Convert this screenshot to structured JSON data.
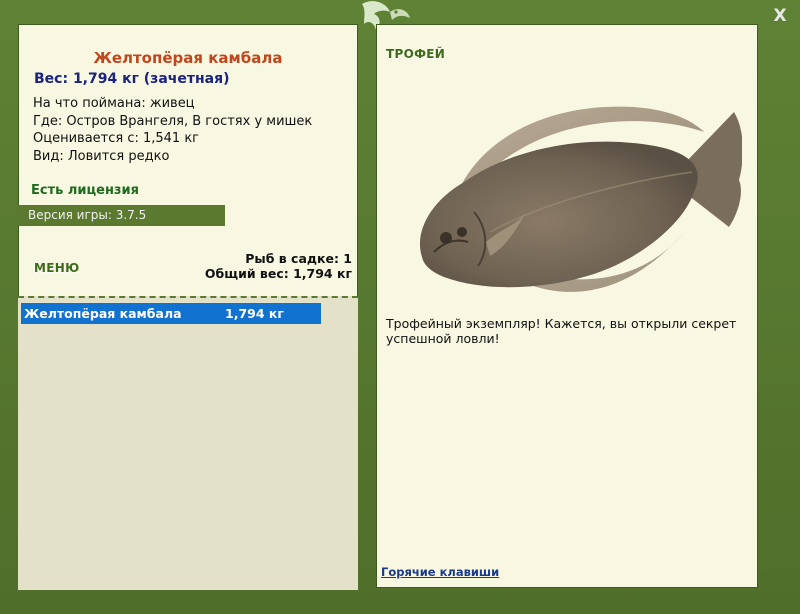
{
  "window": {
    "close_label": "X"
  },
  "left": {
    "fish_name": "Желтопёрая камбала",
    "weight_line": "Вес: 1,794 кг (зачетная)",
    "info_lines": [
      "На что поймана: живец",
      "Где: Остров Врангеля, В гостях у мишек",
      "Оценивается с: 1,541 кг",
      "Вид: Ловится редко"
    ],
    "license": "Есть лицензия",
    "version": "Версия игры: 3.7.5",
    "menu_label": "МЕНЮ",
    "stats": {
      "count": "Рыб в садке: 1",
      "total_weight": "Общий вес: 1,794 кг"
    },
    "catch_list": [
      {
        "name": "Желтопёрая камбала",
        "weight": "1,794 кг"
      }
    ]
  },
  "right": {
    "trophy_label": "ТРОФЕЙ",
    "description": "Трофейный экземпляр! Кажется, вы открыли секрет успешной ловли!",
    "hotkeys_link": "Горячие клавиши"
  },
  "colors": {
    "frame": "#5a7a32",
    "panel": "#f8f7e1",
    "title": "#c0461b",
    "weight": "#1a237e",
    "license": "#1f6a1f",
    "selected_row": "#1172d0",
    "link": "#1a3a8c"
  },
  "icons": {
    "logo": "frog-leaf-logo-icon",
    "close": "close-icon",
    "fish": "flounder-image"
  }
}
